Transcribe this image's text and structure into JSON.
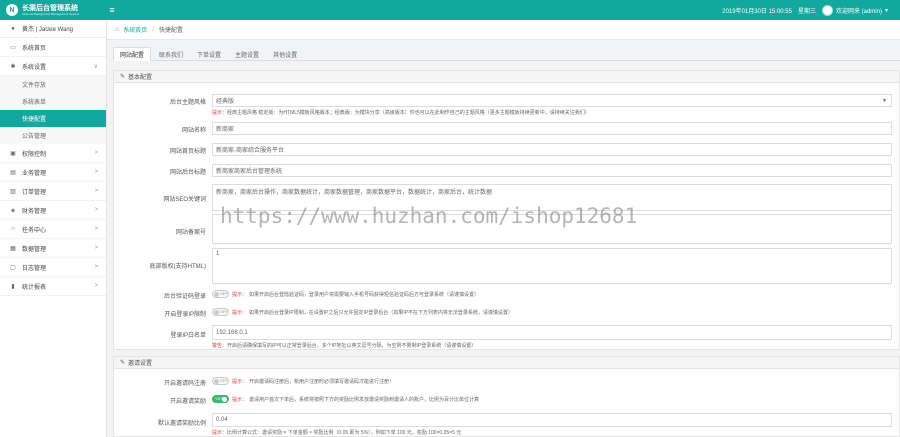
{
  "app": {
    "logo_mark": "N",
    "title": "长渠后台管理系统",
    "subtitle": "Channel Background Management System",
    "menu_icon": "hamburger-icon"
  },
  "topbar": {
    "datetime": "2019年01月30日 15:00:55",
    "weekday": "星期三",
    "welcome": "欢迎网来 (admin)",
    "accent": "#13a89e"
  },
  "sidebar": {
    "user": "黄杰 | Jackie Wang",
    "items": [
      {
        "label": "系统首页",
        "icon": "monitor-icon"
      },
      {
        "label": "系统设置",
        "icon": "gear-icon",
        "chev": "∨"
      },
      {
        "label": "文件存放"
      },
      {
        "label": "系统表单"
      },
      {
        "label": "快捷配置"
      },
      {
        "label": "公告管理"
      },
      {
        "label": "权限控制",
        "icon": "lock-icon",
        "chev": ">"
      },
      {
        "label": "业务管理",
        "icon": "briefcase-icon",
        "chev": ">"
      },
      {
        "label": "订单管理",
        "icon": "cart-icon",
        "chev": ">"
      },
      {
        "label": "财务管理",
        "icon": "wallet-icon",
        "chev": ">"
      },
      {
        "label": "任务中心",
        "icon": "circle-icon",
        "chev": ">"
      },
      {
        "label": "数据管理",
        "icon": "chart-icon",
        "chev": ">"
      },
      {
        "label": "日志管理",
        "icon": "doc-icon",
        "chev": ">"
      },
      {
        "label": "统计报表",
        "icon": "bar-icon",
        "chev": ">"
      }
    ]
  },
  "breadcrumb": {
    "home": "系统首页",
    "current": "快捷配置"
  },
  "tabs": [
    "网站配置",
    "联系我们",
    "下单设置",
    "主题设置",
    "其他设置"
  ],
  "section1": {
    "title": "基本配置",
    "fields": {
      "theme": {
        "label": "后台主题风格",
        "value": "经典版"
      },
      "theme_hint": {
        "red": "提示：",
        "text": "经典主题风格 稳定版：为HTML5模板风格版本；经典版：为模块分享（高级版本）你也可以在此制作自己的主题风格（更多主题模板持续更新中，请持续关注我们）"
      },
      "site_name": {
        "label": "网站名称",
        "value": "新商家"
      },
      "site_title": {
        "label": "网站首页标题",
        "value": "新商家-商家综合服务平台"
      },
      "site_bg": {
        "label": "网站后台标题",
        "value": "新商家商家后台管理系统"
      },
      "seo": {
        "label": "网站SEO关键词",
        "value": "新商家，商家后台操作，商家数据统计，商家数据管理，商家数据平台，数据统计，商家后台，统计数据"
      },
      "icp": {
        "label": "网站备案号",
        "value": ""
      },
      "copyright": {
        "label": "底部版权(支持HTML)",
        "value": "1"
      },
      "login_toggle": {
        "label": "后台验证码登录",
        "state": "OFF",
        "red": "提示：",
        "text": "如果开启后台登陆验证码，登录用户将需要输入手机号码获得短信验证码后方可登录系统（请谨慎设置）"
      },
      "ip_toggle": {
        "label": "开启登录IP限制",
        "state": "OFF",
        "red": "提示：",
        "text": "如果开启后台登录IP限制，在设置IP之后只允许固定IP登录后台（如果IP不在下方列表内将无法登录系统，请谨慎设置）"
      },
      "ip_allow": {
        "label": "登录IP白名单",
        "value": "192.168.0.1"
      },
      "ip_hint": {
        "red": "警告：",
        "text": "开启后请确保填写的IP可以正常登录后台，多个IP地址以英文逗号分隔，为空则不限制IP登录系统（请谨慎设置）"
      }
    }
  },
  "section2": {
    "title": "邀请设置",
    "fields": {
      "invite_toggle": {
        "label": "开启邀请码注册",
        "state": "OFF",
        "red": "提示：",
        "text": "开启邀请码注册后，新用户注册时必须填写邀请码才能进行注册！"
      },
      "reward_toggle": {
        "label": "开启邀请奖励",
        "state": "YES",
        "red": "提示：",
        "text": "邀请用户首次下单后，系统将按照下方的奖励比例发放邀请奖励到邀请人的账户，比例为百分比单位计算"
      },
      "reward_rate": {
        "label": "默认邀请奖励比例",
        "value": "0.04"
      },
      "reward_hint": {
        "red": "提示：",
        "text": "比例计算公式：邀请奖励 = 下单金额 × 奖励比例（0.05 即为 5%），例如下单 100 元，奖励 100×0.05=5 元"
      }
    }
  },
  "watermark": "https://www.huzhan.com/ishop12681"
}
